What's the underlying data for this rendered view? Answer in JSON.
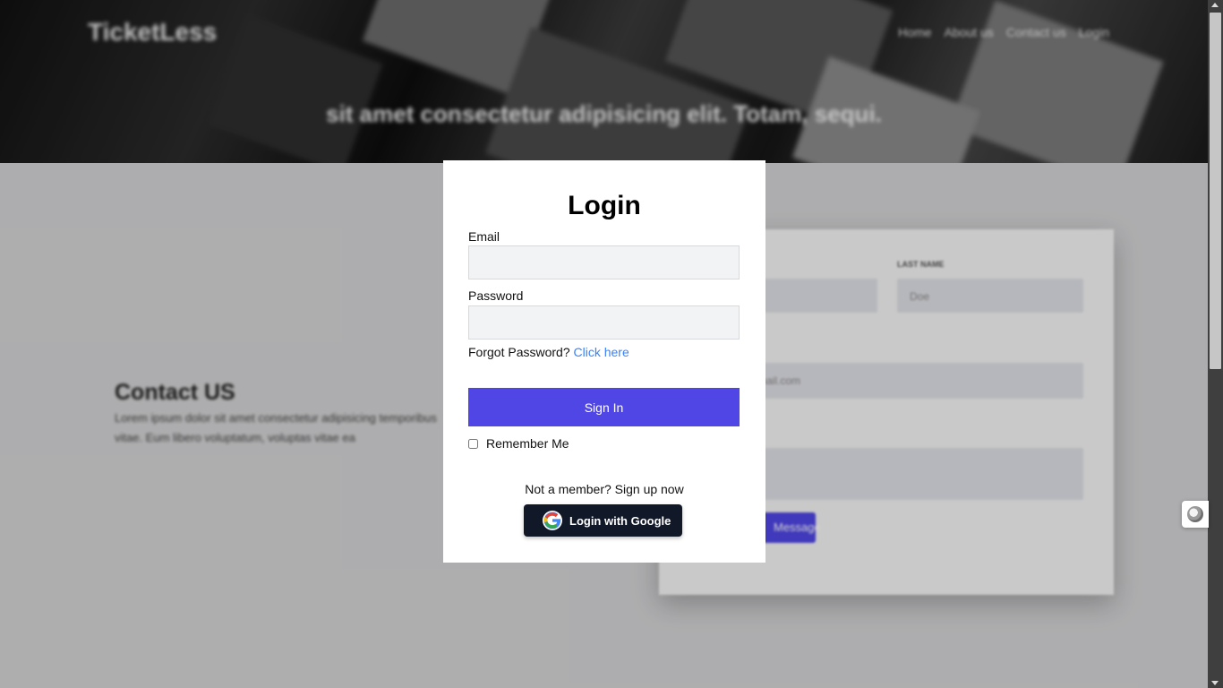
{
  "header": {
    "brand": "TicketLess",
    "nav": [
      "Home",
      "About us",
      "Contact us",
      "Login"
    ],
    "tagline": "sit amet consectetur adipisicing elit. Totam, sequi."
  },
  "contact": {
    "title": "Contact US",
    "text": "Lorem ipsum dolor sit amet consectetur adipisicing temporibus vitae. Eum libero voluptatum, voluptas vitae ea",
    "form": {
      "last_name_label": "LAST NAME",
      "last_name_placeholder": "Doe",
      "email_placeholder": "mail.com",
      "submit_label": "Message"
    }
  },
  "login": {
    "title": "Login",
    "email_label": "Email",
    "email_value": "",
    "password_label": "Password",
    "password_value": "",
    "forgot_text": "Forgot Password?",
    "forgot_link": "Click here",
    "signin_label": "Sign In",
    "remember_label": "Remember Me",
    "remember_checked": false,
    "member_text": "Not a member? Sign up now",
    "google_label": "Login with Google"
  },
  "colors": {
    "accent": "#4f46e5",
    "link": "#3b82f6",
    "google_button": "#111827"
  }
}
